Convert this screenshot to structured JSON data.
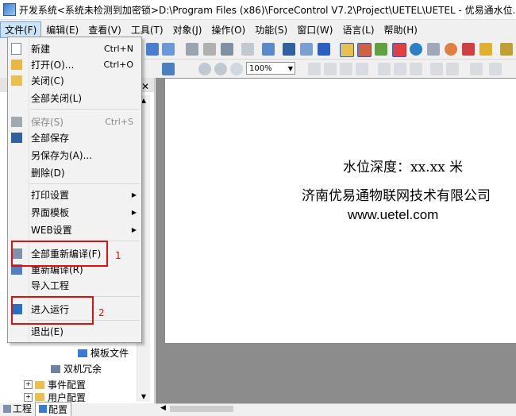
{
  "window": {
    "title": "开发系统<系统未检测到加密锁>D:\\Program Files (x86)\\ForceControl V7.2\\Project\\UETEL\\UETEL - 优易通水位..."
  },
  "menubar": {
    "items": [
      {
        "label": "文件(F)"
      },
      {
        "label": "编辑(E)"
      },
      {
        "label": "查看(V)"
      },
      {
        "label": "工具(T)"
      },
      {
        "label": "对象(J)"
      },
      {
        "label": "操作(O)"
      },
      {
        "label": "功能(S)"
      },
      {
        "label": "窗口(W)"
      },
      {
        "label": "语言(L)"
      },
      {
        "label": "帮助(H)"
      }
    ]
  },
  "toolbar": {
    "zoom_value": "100%"
  },
  "file_menu": {
    "items": [
      {
        "label": "新建",
        "shortcut": "Ctrl+N"
      },
      {
        "label": "打开(O)...",
        "shortcut": "Ctrl+O"
      },
      {
        "label": "关闭(C)",
        "shortcut": ""
      },
      {
        "label": "全部关闭(L)",
        "shortcut": ""
      },
      {
        "label": "保存(S)",
        "shortcut": "Ctrl+S"
      },
      {
        "label": "全部保存",
        "shortcut": ""
      },
      {
        "label": "另保存为(A)...",
        "shortcut": ""
      },
      {
        "label": "删除(D)",
        "shortcut": ""
      },
      {
        "label": "打印设置",
        "shortcut": ""
      },
      {
        "label": "界面模板",
        "shortcut": ""
      },
      {
        "label": "WEB设置",
        "shortcut": ""
      },
      {
        "label": "全部重新编译(F)",
        "shortcut": ""
      },
      {
        "label": "重新编译(R)",
        "shortcut": ""
      },
      {
        "label": "导入工程",
        "shortcut": ""
      },
      {
        "label": "进入运行",
        "shortcut": ""
      },
      {
        "label": "退出(E)",
        "shortcut": ""
      }
    ]
  },
  "annotations": {
    "num1": "1",
    "num2": "2"
  },
  "tree": {
    "items": [
      {
        "label": "模板文件"
      },
      {
        "label": "双机冗余"
      },
      {
        "label": "事件配置"
      },
      {
        "label": "用户配置"
      }
    ]
  },
  "canvas": {
    "line1": "水位深度：xx.xx 米",
    "line2": "济南优易通物联网技术有限公司",
    "line3": "www.uetel.com"
  },
  "tabs": {
    "project": "工程",
    "config": "配置"
  },
  "colors": {
    "accent_red": "#e01010",
    "menu_highlight": "#cce4f7"
  }
}
